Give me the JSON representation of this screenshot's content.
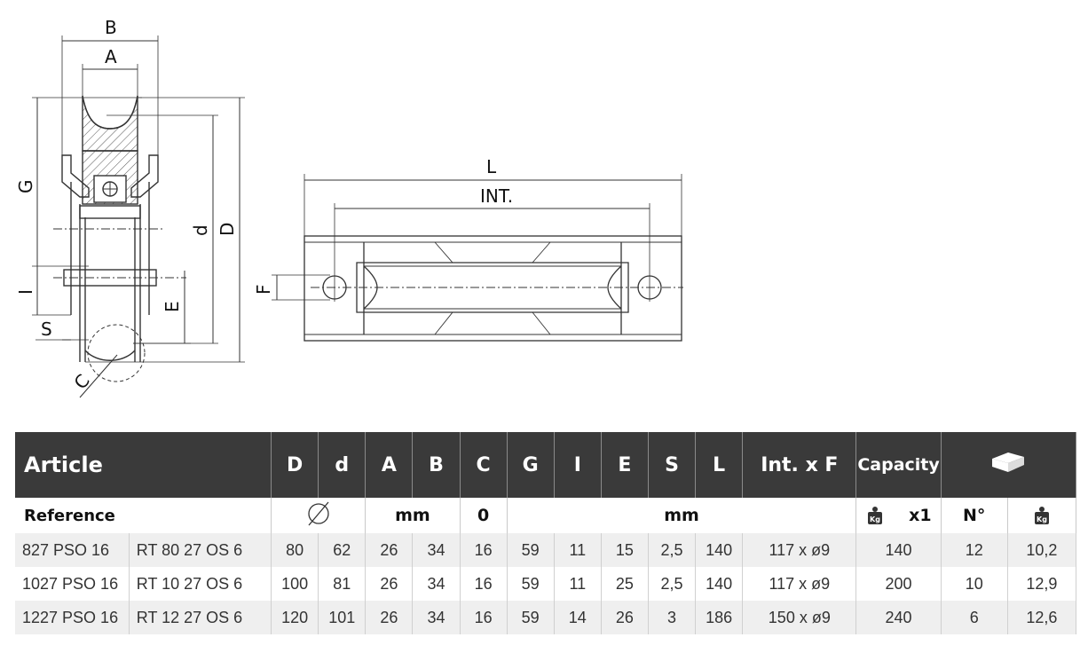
{
  "drawing": {
    "side_view": {
      "dim_B": "B",
      "dim_A": "A",
      "dim_G": "G",
      "dim_d": "d",
      "dim_D": "D",
      "dim_I": "I",
      "dim_E": "E",
      "dim_S": "S",
      "dim_C": "C"
    },
    "top_view": {
      "dim_L": "L",
      "dim_INT": "INT.",
      "dim_F": "F"
    }
  },
  "table": {
    "header": {
      "article": "Article",
      "D": "D",
      "d": "d",
      "A": "A",
      "B": "B",
      "C": "C",
      "G": "G",
      "I": "I",
      "E": "E",
      "S": "S",
      "L": "L",
      "intf": "Int. x F",
      "capacity": "Capacity"
    },
    "units": {
      "reference": "Reference",
      "mm1": "mm",
      "zero": "0",
      "mm2": "mm",
      "x1": "x1",
      "n": "N°"
    },
    "rows": [
      {
        "ref": "827 PSO 16",
        "ref2": "RT 80 27 OS 6",
        "D": "80",
        "d": "62",
        "A": "26",
        "B": "34",
        "C": "16",
        "G": "59",
        "I": "11",
        "E": "15",
        "S": "2,5",
        "L": "140",
        "intf": "117 x ø9",
        "cap": "140",
        "n": "12",
        "w": "10,2"
      },
      {
        "ref": "1027 PSO 16",
        "ref2": "RT 10 27 OS 6",
        "D": "100",
        "d": "81",
        "A": "26",
        "B": "34",
        "C": "16",
        "G": "59",
        "I": "11",
        "E": "25",
        "S": "2,5",
        "L": "140",
        "intf": "117 x ø9",
        "cap": "200",
        "n": "10",
        "w": "12,9"
      },
      {
        "ref": "1227 PSO 16",
        "ref2": "RT 12 27 OS 6",
        "D": "120",
        "d": "101",
        "A": "26",
        "B": "34",
        "C": "16",
        "G": "59",
        "I": "14",
        "E": "26",
        "S": "3",
        "L": "186",
        "intf": "150 x ø9",
        "cap": "240",
        "n": "6",
        "w": "12,6"
      }
    ],
    "icons": {
      "diameter": "diameter-icon",
      "weight": "weight-kg-icon",
      "box": "box-icon"
    }
  }
}
